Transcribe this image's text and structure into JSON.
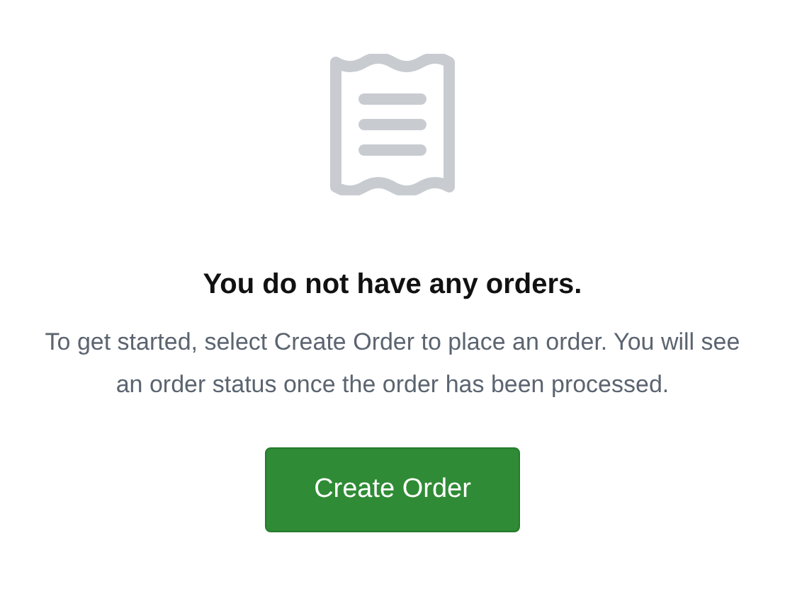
{
  "empty_state": {
    "title": "You do not have any orders.",
    "message": "To get started, select Create Order to place an order. You will see an order status once the order has been processed.",
    "button": "Create Order"
  }
}
